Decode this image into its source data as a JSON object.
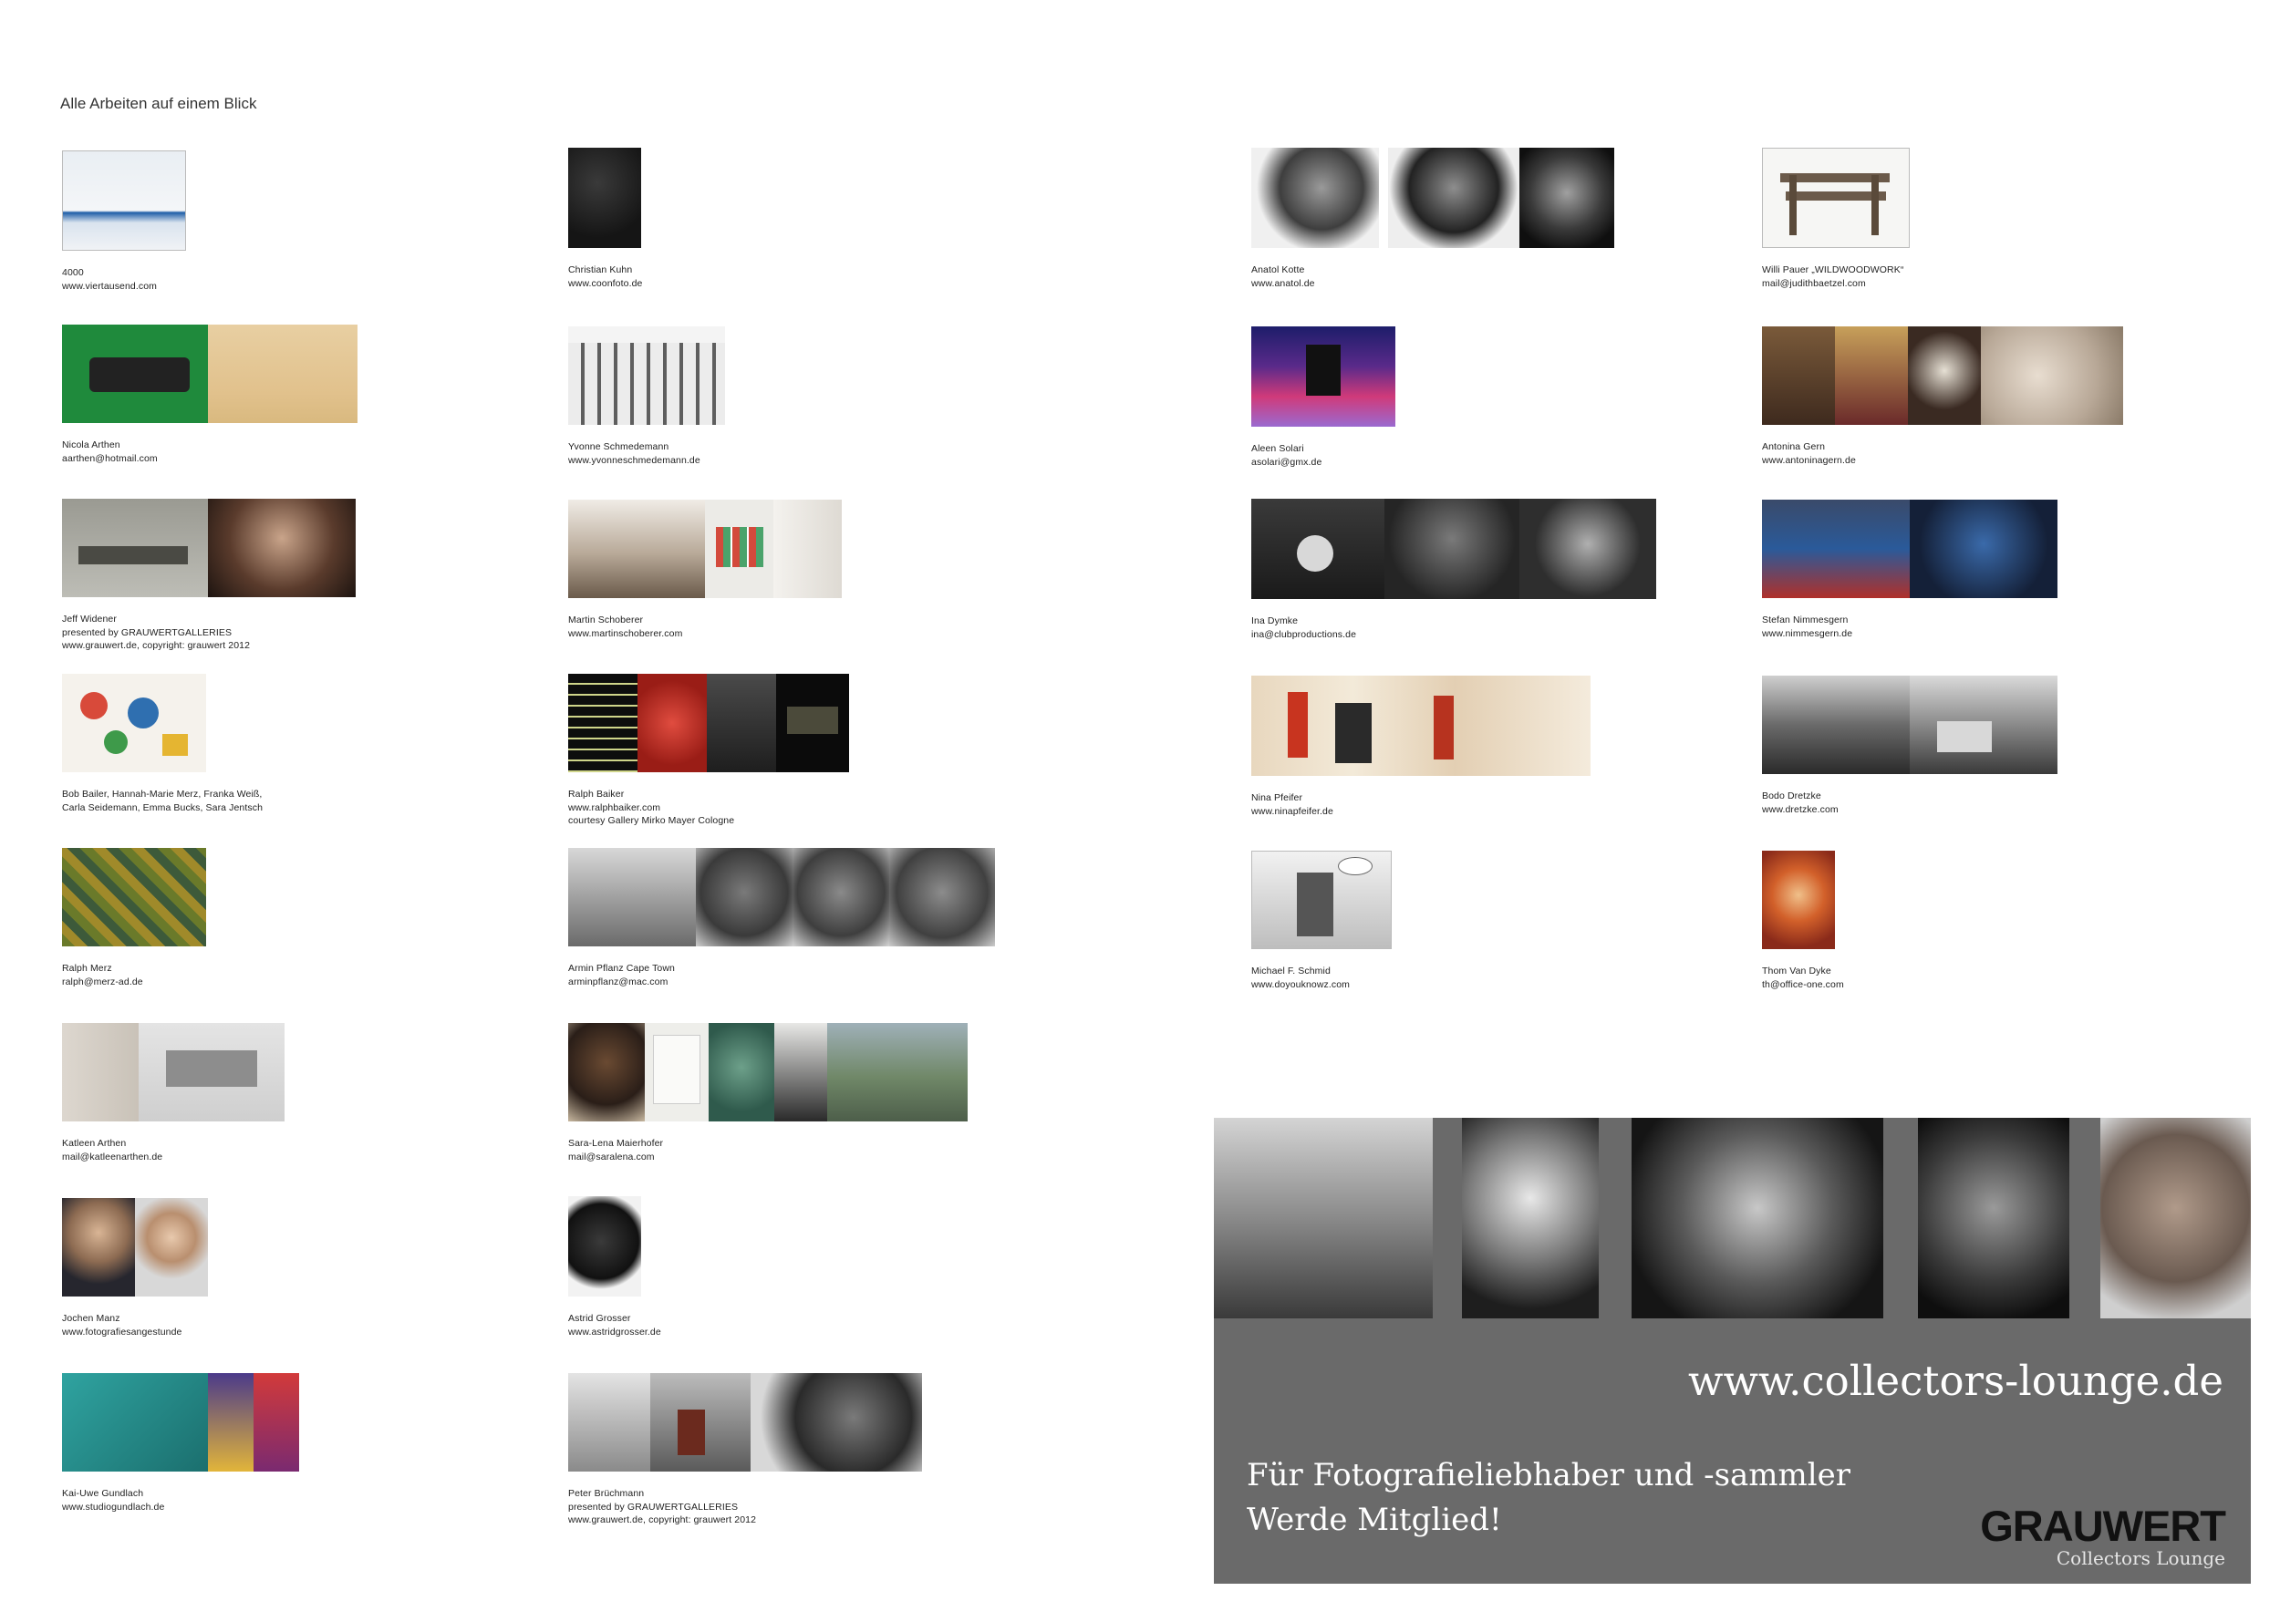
{
  "heading": "Alle Arbeiten auf einem Blick",
  "entries": [
    {
      "lines": [
        "4000",
        "www.viertausend.com"
      ]
    },
    {
      "lines": [
        "Nicola Arthen",
        "aarthen@hotmail.com"
      ]
    },
    {
      "lines": [
        "Jeff Widener",
        "presented by GRAUWERTGALLERIES",
        "www.grauwert.de, copyright: grauwert 2012"
      ]
    },
    {
      "lines": [
        "Bob Bailer, Hannah-Marie Merz, Franka Weiß,",
        "Carla Seidemann, Emma Bucks, Sara Jentsch"
      ]
    },
    {
      "lines": [
        "Ralph Merz",
        "ralph@merz-ad.de"
      ]
    },
    {
      "lines": [
        "Katleen Arthen",
        "mail@katleenarthen.de"
      ]
    },
    {
      "lines": [
        "Jochen Manz",
        "www.fotografiesangestunde"
      ]
    },
    {
      "lines": [
        "Kai-Uwe Gundlach",
        "www.studiogundlach.de"
      ]
    },
    {
      "lines": [
        "Christian Kuhn",
        "www.coonfoto.de"
      ]
    },
    {
      "lines": [
        "Yvonne Schmedemann",
        "www.yvonneschmedemann.de"
      ]
    },
    {
      "lines": [
        "Martin Schoberer",
        "www.martinschoberer.com"
      ]
    },
    {
      "lines": [
        "Ralph Baiker",
        "www.ralphbaiker.com",
        "courtesy Gallery Mirko Mayer Cologne"
      ]
    },
    {
      "lines": [
        "Armin Pflanz   Cape Town",
        "arminpflanz@mac.com"
      ]
    },
    {
      "lines": [
        "Sara-Lena Maierhofer",
        "mail@saralena.com"
      ]
    },
    {
      "lines": [
        "Astrid Grosser",
        "www.astridgrosser.de"
      ]
    },
    {
      "lines": [
        "Peter Brüchmann",
        "presented by GRAUWERTGALLERIES",
        "www.grauwert.de, copyright: grauwert 2012"
      ]
    },
    {
      "lines": [
        "Anatol Kotte",
        "www.anatol.de"
      ]
    },
    {
      "lines": [
        "Aleen Solari",
        "asolari@gmx.de"
      ]
    },
    {
      "lines": [
        "Ina Dymke",
        "ina@clubproductions.de"
      ]
    },
    {
      "lines": [
        "Nina Pfeifer",
        "www.ninapfeifer.de"
      ]
    },
    {
      "lines": [
        "Michael F. Schmid",
        "www.doyouknowz.com"
      ]
    },
    {
      "lines": [
        "Willi Pauer „WILDWOODWORK“",
        "mail@judithbaetzel.com"
      ]
    },
    {
      "lines": [
        "Antonina Gern",
        "www.antoninagern.de"
      ]
    },
    {
      "lines": [
        "Stefan Nimmesgern",
        "www.nimmesgern.de"
      ]
    },
    {
      "lines": [
        "Bodo Dretzke",
        "www.dretzke.com"
      ]
    },
    {
      "lines": [
        "Thom Van Dyke",
        "th@office-one.com"
      ]
    }
  ],
  "ad": {
    "url": "www.collectors-lounge.de",
    "line1": "Für Fotografieliebhaber und -sammler",
    "line2": "Werde Mitglied!",
    "brand": "GRAUWERT",
    "sub": "Collectors Lounge"
  }
}
